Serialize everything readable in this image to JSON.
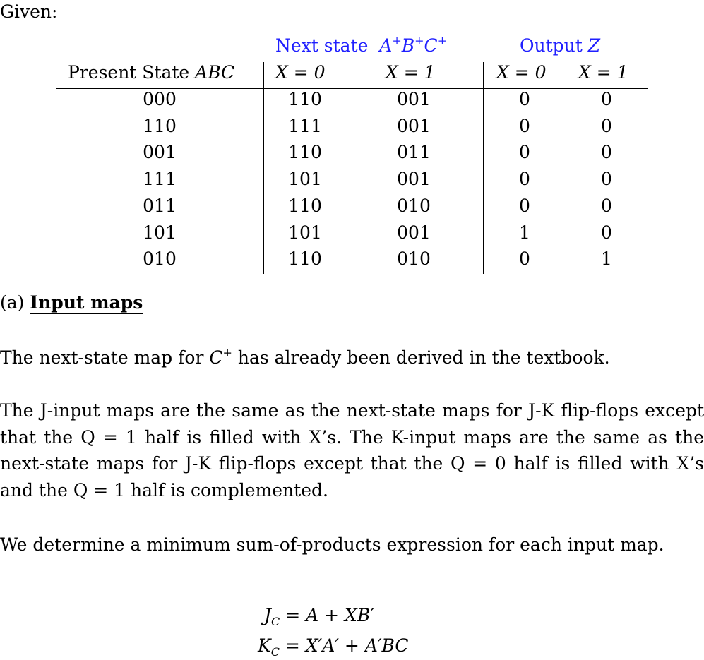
{
  "intro": "Given:",
  "table": {
    "group_headers": {
      "next_state": {
        "text": "Next state",
        "vars": [
          "A",
          "B",
          "C"
        ],
        "sup": "+"
      },
      "output": {
        "text": "Output",
        "var": "Z"
      }
    },
    "column_headers": {
      "present_state": {
        "text": "Present State",
        "var": "ABC"
      },
      "next_x0": "X = 0",
      "next_x1": "X = 1",
      "out_x0": "X = 0",
      "out_x1": "X = 1"
    },
    "rows": [
      {
        "present": "000",
        "next_x0": "110",
        "next_x1": "001",
        "z_x0": "0",
        "z_x1": "0"
      },
      {
        "present": "110",
        "next_x0": "111",
        "next_x1": "001",
        "z_x0": "0",
        "z_x1": "0"
      },
      {
        "present": "001",
        "next_x0": "110",
        "next_x1": "011",
        "z_x0": "0",
        "z_x1": "0"
      },
      {
        "present": "111",
        "next_x0": "101",
        "next_x1": "001",
        "z_x0": "0",
        "z_x1": "0"
      },
      {
        "present": "011",
        "next_x0": "110",
        "next_x1": "010",
        "z_x0": "0",
        "z_x1": "0"
      },
      {
        "present": "101",
        "next_x0": "101",
        "next_x1": "001",
        "z_x0": "1",
        "z_x1": "0"
      },
      {
        "present": "010",
        "next_x0": "110",
        "next_x1": "010",
        "z_x0": "0",
        "z_x1": "1"
      }
    ]
  },
  "section": {
    "label": "(a)",
    "title": "Input maps"
  },
  "paragraphs": {
    "p1": {
      "before": "The next-state map for ",
      "var": "C",
      "sup": "+",
      "after": " has already been derived in the textbook."
    },
    "p2": "The J-input maps are the same as the next-state maps for J-K flip-flops except that the Q = 1 half is filled with X’s. The K-input maps are the same as the next-state maps for J-K flip-flops except that the Q = 0 half is filled with X’s and the Q = 1 half is complemented.",
    "p3": "We determine a minimum sum-of-products expression for each input map."
  },
  "equations": [
    {
      "lhs": "J",
      "sub": "C",
      "rhs": "= A + XB′"
    },
    {
      "lhs": "K",
      "sub": "C",
      "rhs": "= X′A′ + A′BC"
    }
  ],
  "colors": {
    "header_blue": "#1f1fff"
  }
}
